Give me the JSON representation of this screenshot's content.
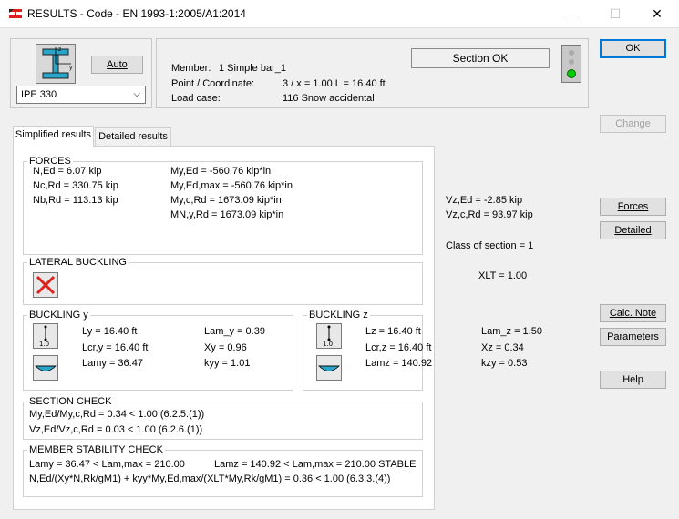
{
  "window": {
    "title": "RESULTS - Code - EN 1993-1:2005/A1:2014",
    "minimize": "—",
    "maximize": "☐",
    "close": "✕"
  },
  "section": {
    "auto_label": "Auto",
    "profile": "IPE 330",
    "status": "Section OK",
    "status_color": "#00cc00"
  },
  "info": {
    "member_label": "Member:",
    "member_value": "1  Simple bar_1",
    "point_label": "Point / Coordinate:",
    "point_value": "3 / x = 1.00 L = 16.40 ft",
    "load_label": "Load case:",
    "load_value": "116  Snow accidental"
  },
  "tabs": {
    "simplified": "Simplified results",
    "detailed": "Detailed results"
  },
  "forces": {
    "title": "FORCES",
    "n_ed": "N,Ed = 6.07 kip",
    "nc_rd": "Nc,Rd = 330.75 kip",
    "nb_rd": "Nb,Rd = 113.13 kip",
    "my_ed": "My,Ed = -560.76 kip*in",
    "my_ed_max": "My,Ed,max = -560.76 kip*in",
    "my_c_rd": "My,c,Rd = 1673.09 kip*in",
    "mn_y_rd": "MN,y,Rd = 1673.09 kip*in",
    "vz_ed": "Vz,Ed = -2.85 kip",
    "vz_c_rd": "Vz,c,Rd = 93.97 kip",
    "class": "Class of section = 1"
  },
  "lateral": {
    "title": "LATERAL BUCKLING",
    "xlt": "XLT = 1.00"
  },
  "buckling_y": {
    "title": "BUCKLING y",
    "icon_label": "1.0",
    "ly": "Ly = 16.40 ft",
    "lcr_y": "Lcr,y = 16.40 ft",
    "lamy": "Lamy = 36.47",
    "lam_y": "Lam_y = 0.39",
    "xy": "Xy = 0.96",
    "kyy": "kyy = 1.01"
  },
  "buckling_z": {
    "title": "BUCKLING z",
    "icon_label": "1.0",
    "lz": "Lz = 16.40 ft",
    "lcr_z": "Lcr,z = 16.40 ft",
    "lamz": "Lamz = 140.92",
    "lam_z": "Lam_z = 1.50",
    "xz": "Xz = 0.34",
    "kzy": "kzy = 0.53"
  },
  "section_check": {
    "title": "SECTION CHECK",
    "line1": "My,Ed/My,c,Rd = 0.34 < 1.00   (6.2.5.(1))",
    "line2": "Vz,Ed/Vz,c,Rd = 0.03 < 1.00   (6.2.6.(1))"
  },
  "member_check": {
    "title": "MEMBER STABILITY CHECK",
    "line1a": "Lamy = 36.47 < Lam,max = 210.00",
    "line1b": "Lamz = 140.92 < Lam,max = 210.00    STABLE",
    "line2": "N,Ed/(Xy*N,Rk/gM1) + kyy*My,Ed,max/(XLT*My,Rk/gM1) = 0.36 < 1.00   (6.3.3.(4))"
  },
  "buttons": {
    "ok": "OK",
    "change": "Change",
    "forces": "Forces",
    "detailed": "Detailed",
    "calc_note": "Calc. Note",
    "parameters": "Parameters",
    "help": "Help"
  }
}
